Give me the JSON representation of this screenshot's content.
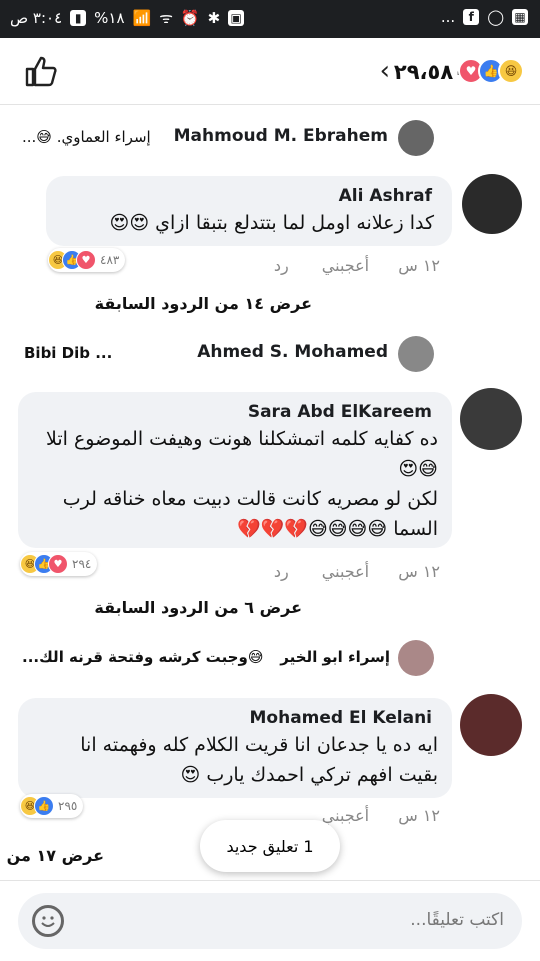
{
  "status_bar": {
    "time": "٣:٠٤ ص",
    "battery": "%١٨",
    "signal": "‖",
    "icons": [
      "battery-icon",
      "signal-icon",
      "wifi-icon",
      "alarm-icon",
      "bluetooth-icon",
      "facebook-icon",
      "whatsapp-icon",
      "gallery-icon"
    ],
    "more": "..."
  },
  "header": {
    "reactions_count": "٢٩،٥٨٠",
    "reaction_types": [
      "love",
      "like",
      "haha"
    ]
  },
  "top_reply": {
    "author": "Mahmoud M. Ebrahem",
    "preview": "إسراء العماوي. 😅..."
  },
  "comments": [
    {
      "author": "Ali Ashraf",
      "text": "كدا زعلانه اومل لما بتتدلع بتبقا ازاي 😍😍",
      "time": "١٢ س",
      "like": "أعجبني",
      "reply": "رد",
      "reactions_count": "٤٨٣",
      "reaction_types": [
        "love",
        "like",
        "haha"
      ],
      "prev_replies": "عرض ١٤ من الردود السابقة"
    },
    {
      "author": "Sara Abd ElKareem",
      "text_line1": "ده كفايه كلمه اتمشكلنا هونت وهيفت الموضوع اتلا 😅😍",
      "text_line2": "لكن لو مصريه كانت قالت دبيت معاه خناقه لرب السما 😅😅😅😅💔💔💔",
      "time": "١٢ س",
      "like": "أعجبني",
      "reply": "رد",
      "reactions_count": "٢٩٤",
      "reaction_types": [
        "love",
        "like",
        "haha"
      ],
      "prev_replies": "عرض ٦ من الردود السابقة"
    },
    {
      "author": "Mohamed El Kelani",
      "text_line1": "ايه ده يا جدعان انا قريت الكلام كله وفهمته انا",
      "text_line2": "بقيت افهم تركي احمدك يارب 😍",
      "time": "١٢ س",
      "like": "أعجبني",
      "reactions_count": "٢٩٥",
      "reaction_types": [
        "like",
        "haha"
      ],
      "prev_replies": "عرض ١٧ من"
    }
  ],
  "mid_reply_1": {
    "author": "Ahmed S. Mohamed",
    "preview": "Bibi Dib ..."
  },
  "mid_reply_2": {
    "author": "إسراء ابو الخير",
    "preview": "😅وجبت كرشه وفتحة قرنه الك..."
  },
  "toast": "1 تعليق جديد",
  "composer": {
    "placeholder": "اكتب تعليقًا..."
  }
}
